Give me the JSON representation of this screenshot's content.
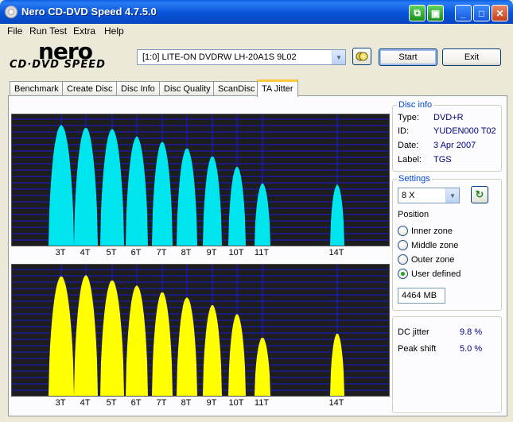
{
  "window": {
    "title": "Nero CD-DVD Speed 4.7.5.0"
  },
  "menu": [
    "File",
    "Run Test",
    "Extra",
    "Help"
  ],
  "logo": {
    "brand": "nero",
    "product": "CD·DVD SPEED"
  },
  "drive": {
    "selected": "[1:0]  LITE-ON DVDRW LH-20A1S 9L02"
  },
  "buttons": {
    "start": "Start",
    "exit": "Exit"
  },
  "tabs": [
    "Benchmark",
    "Create Disc",
    "Disc Info",
    "Disc Quality",
    "ScanDisc",
    "TA Jitter"
  ],
  "disc_info": {
    "title": "Disc info",
    "type_label": "Type:",
    "type_value": "DVD+R",
    "id_label": "ID:",
    "id_value": "YUDEN000 T02",
    "date_label": "Date:",
    "date_value": "3 Apr 2007",
    "label_label": "Label:",
    "label_value": "TGS"
  },
  "settings": {
    "title": "Settings",
    "speed": "8 X",
    "position_label": "Position",
    "positions": [
      "Inner zone",
      "Middle zone",
      "Outer zone",
      "User defined"
    ],
    "selected_position": "User defined",
    "size": "4464 MB"
  },
  "results": {
    "dc_jitter_label": "DC jitter",
    "dc_jitter_value": "9.8 %",
    "peak_shift_label": "Peak shift",
    "peak_shift_value": "5.0 %"
  },
  "colors": {
    "land_color": "#00e5ee",
    "groove_color": "#ffff00",
    "plot_bg": "#1e1e1e",
    "grid": "#1a1adc"
  },
  "chart_data": [
    {
      "type": "bar",
      "series": "land",
      "categories": [
        "3T",
        "4T",
        "5T",
        "6T",
        "7T",
        "8T",
        "9T",
        "10T",
        "11T",
        "14T"
      ],
      "values": [
        0.93,
        0.91,
        0.9,
        0.84,
        0.8,
        0.75,
        0.69,
        0.61,
        0.48,
        0.47
      ],
      "ylim": [
        0,
        1
      ],
      "grid": true
    },
    {
      "type": "bar",
      "series": "groove",
      "categories": [
        "3T",
        "4T",
        "5T",
        "6T",
        "7T",
        "8T",
        "9T",
        "10T",
        "11T",
        "14T"
      ],
      "values": [
        0.92,
        0.93,
        0.89,
        0.85,
        0.8,
        0.76,
        0.7,
        0.63,
        0.45,
        0.48
      ],
      "ylim": [
        0,
        1
      ],
      "grid": true
    }
  ]
}
